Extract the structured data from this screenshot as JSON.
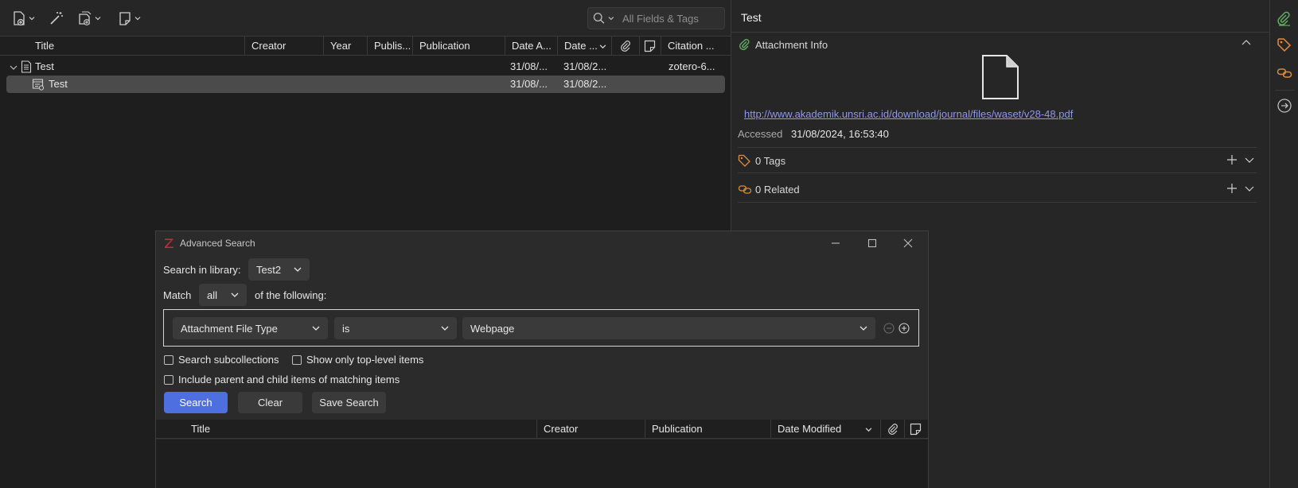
{
  "toolbar": {
    "new_item_icon": "new-item-icon",
    "magic_wand_icon": "magic-wand-icon",
    "add_attachment_icon": "add-attachment-icon",
    "new_note_icon": "new-note-icon",
    "search_placeholder": "All Fields & Tags"
  },
  "tree": {
    "columns": [
      "Title",
      "Creator",
      "Year",
      "Publis...",
      "Publication",
      "Date A...",
      "Date ...",
      "",
      "",
      "Citation ..."
    ],
    "rows": [
      {
        "title": "Test",
        "date_added": "31/08/...",
        "date_modified": "31/08/2...",
        "citation": "zotero-6..."
      },
      {
        "title": "Test",
        "date_added": "31/08/...",
        "date_modified": "31/08/2...",
        "citation": ""
      }
    ]
  },
  "item_pane": {
    "title": "Test",
    "attachment_info": "Attachment Info",
    "url": "http://www.akademik.unsri.ac.id/download/journal/files/waset/v28-48.pdf",
    "accessed_label": "Accessed",
    "accessed_value": "31/08/2024, 16:53:40",
    "tags": "0 Tags",
    "related": "0 Related"
  },
  "dialog": {
    "title": "Advanced Search",
    "search_in_library_label": "Search in library:",
    "library": "Test2",
    "match_label": "Match",
    "match_mode": "all",
    "of_following": "of the following:",
    "condition": {
      "field": "Attachment File Type",
      "operator": "is",
      "value": "Webpage"
    },
    "search_subcollections": "Search subcollections",
    "show_top_level": "Show only top-level items",
    "include_parent_child": "Include parent and child items of matching items",
    "search_button": "Search",
    "clear_button": "Clear",
    "save_search_button": "Save Search",
    "results_columns": [
      "Title",
      "Creator",
      "Publication",
      "Date Modified"
    ]
  },
  "colors": {
    "accent_blue": "#4d6fe0",
    "link": "#8f97f2",
    "attachment_green": "#5fae62",
    "tag_orange": "#e58a3c",
    "related_orange": "#d9893c",
    "zotero_red": "#cc2936"
  }
}
